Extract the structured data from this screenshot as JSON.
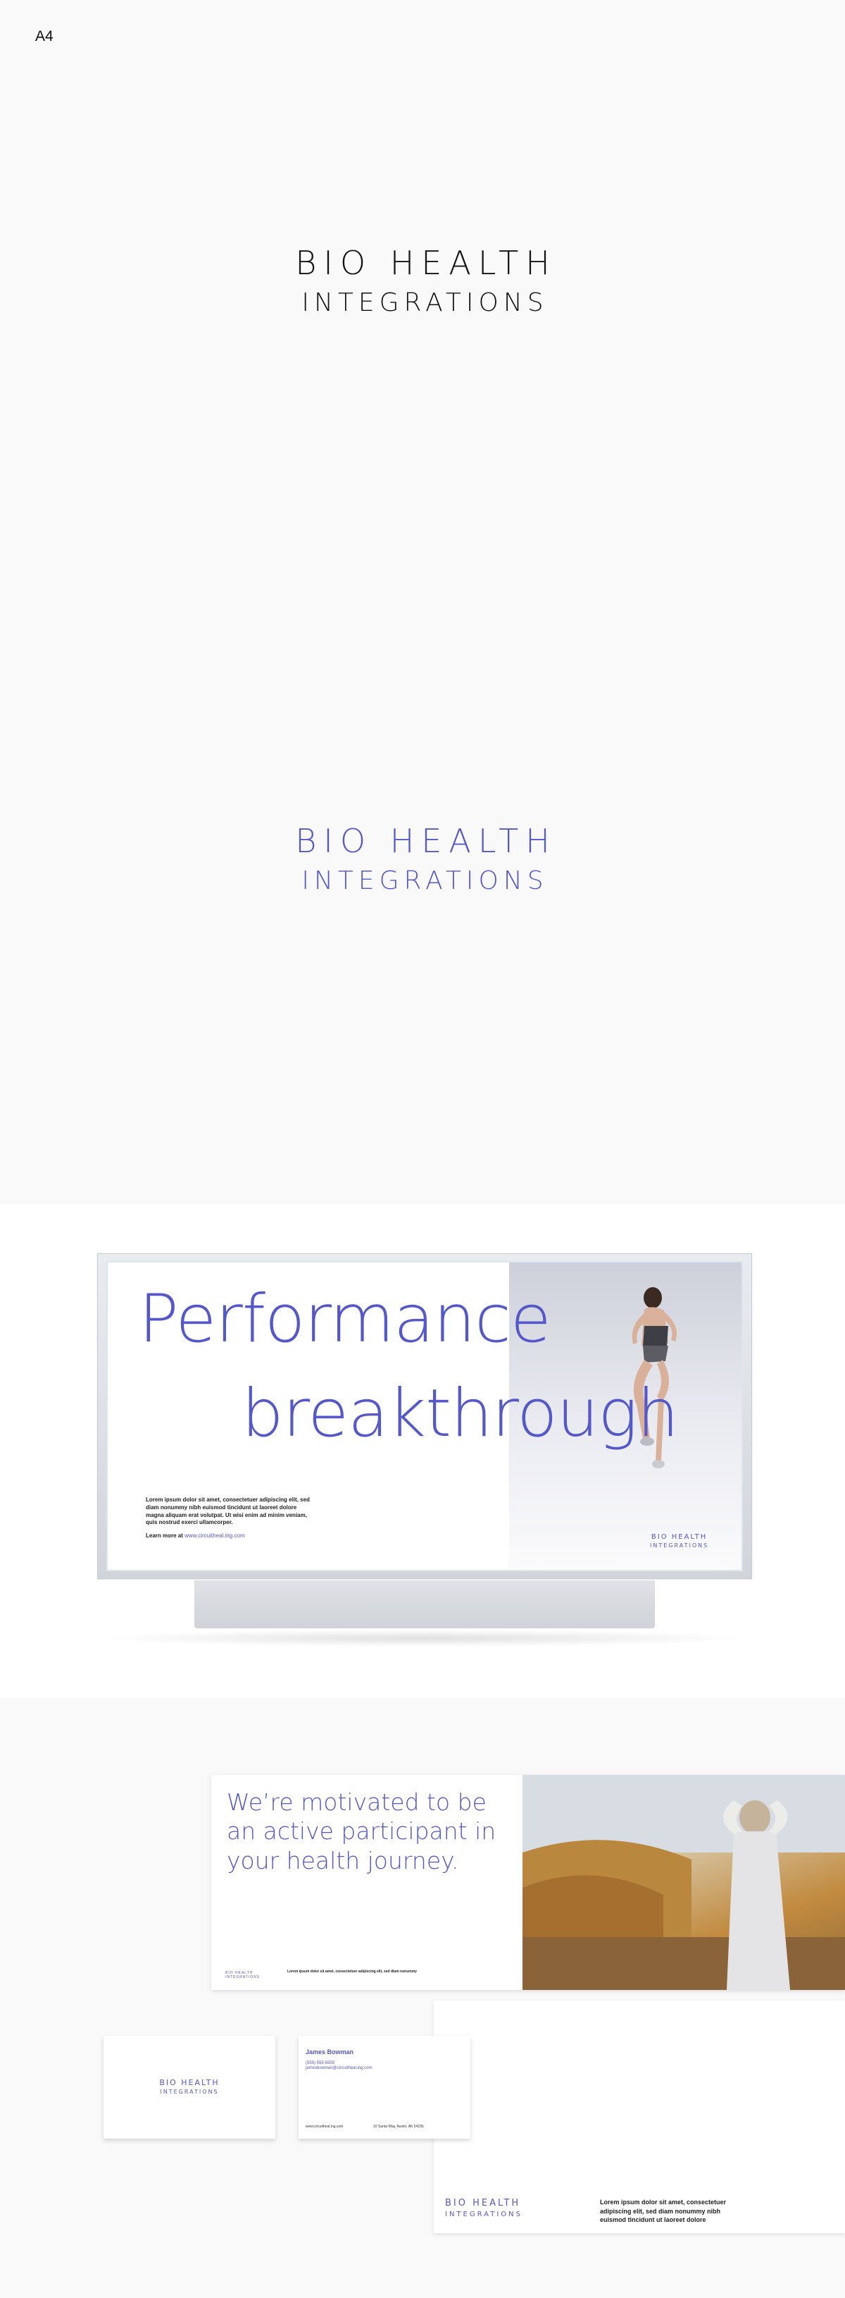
{
  "page_label": "A4",
  "logo": {
    "line1": "BIO HEALTH",
    "line2": "INTEGRATIONS",
    "colors": {
      "black": "#141414",
      "brand_blue": "#5458c9"
    }
  },
  "billboard": {
    "headline_line1": "Performance",
    "headline_line2": "breakthrough",
    "body": "Lorem ipsum dolor sit amet, consectetuer adipiscing elit, sed diam nonummy nibh euismod tincidunt ut laoreet dolore magna aliquam erat volutpat. Ut wisi enim ad minim veniam, quis nostrud exerci ullamcorper.",
    "learn_more_label": "Learn more at",
    "learn_more_url": "www.circuitheal.ing.com",
    "logo_line1": "BIO HEALTH",
    "logo_line2": "INTEGRATIONS"
  },
  "brochure": {
    "tagline": "We’re motivated to be an active participant in your health journey.",
    "logo_line1": "BIO HEALTH",
    "logo_line2": "INTEGRATIONS",
    "fine_print": "Lorem ipsum dolor sit amet, consectetuer adipiscing elit, sed diam nonummy"
  },
  "business_card": {
    "front_logo_line1": "BIO HEALTH",
    "front_logo_line2": "INTEGRATIONS",
    "name": "James Bowman",
    "phone": "(555) 555-5555",
    "email": "jamesbowman@circuitheal.ing.com",
    "website": "www.circuitheal.ing.com",
    "address": "10 Santa Way, Austin, AK 54295"
  },
  "letterhead": {
    "logo_line1": "BIO HEALTH",
    "logo_line2": "INTEGRATIONS",
    "body": "Lorem ipsum dolor sit amet, consectetuer adipiscing elit, sed diam nonummy nibh euismod tincidunt ut laoreet dolore"
  }
}
